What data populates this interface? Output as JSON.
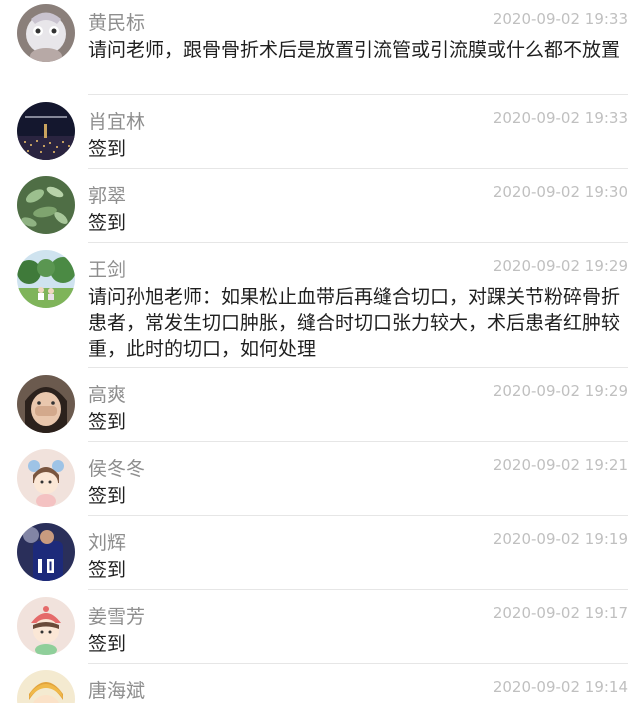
{
  "comments": [
    {
      "name": "黄民标",
      "time": "2020-09-02 19:33",
      "text": "请问老师，跟骨骨折术后是放置引流管或引流膜或什么都不放置",
      "avatar": "cartoon-character-avatar"
    },
    {
      "name": "肖宜林",
      "time": "2020-09-02 19:33",
      "text": "签到",
      "avatar": "city-night-avatar"
    },
    {
      "name": "郭翠",
      "time": "2020-09-02 19:30",
      "text": "签到",
      "avatar": "plant-leaves-avatar"
    },
    {
      "name": "王剑",
      "time": "2020-09-02 19:29",
      "text": "请问孙旭老师：如果松止血带后再缝合切口，对踝关节粉碎骨折患者，常发生切口肿胀，缝合时切口张力较大，术后患者红肿较重，此时的切口，如何处理",
      "avatar": "park-scene-avatar"
    },
    {
      "name": "高爽",
      "time": "2020-09-02 19:29",
      "text": "签到",
      "avatar": "child-photo-avatar"
    },
    {
      "name": "侯冬冬",
      "time": "2020-09-02 19:21",
      "text": "签到",
      "avatar": "cartoon-girl-avatar"
    },
    {
      "name": "刘辉",
      "time": "2020-09-02 19:19",
      "text": "签到",
      "avatar": "football-player-avatar"
    },
    {
      "name": "姜雪芳",
      "time": "2020-09-02 19:17",
      "text": "签到",
      "avatar": "cartoon-girl-hat-avatar"
    },
    {
      "name": "唐海斌",
      "time": "2020-09-02 19:14",
      "text": "",
      "avatar": "cartoon-boy-avatar"
    }
  ]
}
